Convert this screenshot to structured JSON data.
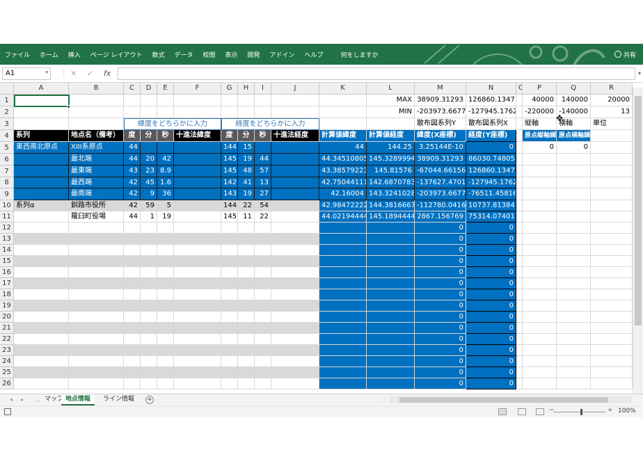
{
  "ribbon": {
    "tabs": [
      "ファイル",
      "ホーム",
      "挿入",
      "ページ レイアウト",
      "数式",
      "データ",
      "校閲",
      "表示",
      "開発",
      "アドイン",
      "ヘルプ",
      "何をしますか"
    ],
    "share": "共有",
    "color": "#217346"
  },
  "formula_bar": {
    "name_box": "A1",
    "cancel": "✕",
    "confirm": "✓",
    "fx": "fx",
    "formula": ""
  },
  "columns": [
    "A",
    "B",
    "C",
    "D",
    "E",
    "F",
    "G",
    "H",
    "I",
    "J",
    "K",
    "L",
    "M",
    "N",
    "O",
    "P",
    "Q",
    "R"
  ],
  "rows": [
    "1",
    "2",
    "3",
    "4",
    "5",
    "6",
    "7",
    "8",
    "9",
    "10",
    "11",
    "12",
    "13",
    "14",
    "15",
    "16",
    "17",
    "18",
    "19",
    "20",
    "21",
    "22",
    "23",
    "24",
    "25",
    "26"
  ],
  "cells": {
    "L1": "MAX",
    "M1": "38909.31293",
    "N1": "126860.1347",
    "P1": "40000",
    "Q1": "140000",
    "R1": "20000",
    "L2": "MIN",
    "M2": "-203973.6677",
    "N2": "-127945.1762",
    "P2": "-220000",
    "Q2": "-140000",
    "R2": "13",
    "C3": "緯度をどちらかに入力",
    "G3": "経度をどちらかに入力",
    "M3": "散布図系列Y",
    "N3": "散布図系列X",
    "P3": "縦軸",
    "Q3": "横軸",
    "R3": "単位",
    "A4": "系列",
    "B4": "地点名（備考）",
    "C4": "度",
    "D4": "分",
    "E4": "秒",
    "F4": "十進法緯度",
    "G4": "度",
    "H4": "分",
    "I4": "秒",
    "J4": "十進法経度",
    "K4": "計算値緯度",
    "L4": "計算値経度",
    "M4": "緯度(X座標)",
    "N4": "経度(Y座標)",
    "P4": "原点縦軸調",
    "Q4": "原点横軸調",
    "A5": "東西南北原点",
    "B5": "XIII系原点",
    "C5": "44",
    "G5": "144",
    "H5": "15",
    "K5": "44",
    "L5": "144.25",
    "M5": "3.25144E-10",
    "N5": "0",
    "P5": "0",
    "Q5": "0",
    "B6": "最北端",
    "C6": "44",
    "D6": "20",
    "E6": "42",
    "G6": "145",
    "H6": "19",
    "I6": "44",
    "K6": "44.34510805",
    "L6": "145.3289994",
    "M6": "38909.31293",
    "N6": "86030.74805",
    "B7": "最東端",
    "C7": "43",
    "D7": "23",
    "E7": "8.9",
    "G7": "145",
    "H7": "48",
    "I7": "57",
    "K7": "43.38579223",
    "L7": "145.81576",
    "M7": "-67044.66156",
    "N7": "126860.1347",
    "B8": "最西端",
    "C8": "42",
    "D8": "45",
    "E8": "1.6",
    "G8": "142",
    "H8": "41",
    "I8": "13",
    "K8": "42.75044111",
    "L8": "142.6870783",
    "M8": "-137627.4701",
    "N8": "-127945.1762",
    "B9": "最南端",
    "C9": "42",
    "D9": "9",
    "E9": "36",
    "G9": "143",
    "H9": "19",
    "I9": "27",
    "K9": "42.16004",
    "L9": "143.3241028",
    "M9": "-203973.6677",
    "N9": "-76511.45816",
    "A10": "系列α",
    "B10": "釧路市役所",
    "C10": "42",
    "D10": "59",
    "E10": "5",
    "G10": "144",
    "H10": "22",
    "I10": "54",
    "K10": "42.98472222",
    "L10": "144.3816667",
    "M10": "-112780.0416",
    "N10": "10737.81384",
    "B11": "羅臼町役場",
    "C11": "44",
    "D11": "1",
    "E11": "19",
    "G11": "145",
    "H11": "11",
    "I11": "22",
    "K11": "44.02194444",
    "L11": "145.1894444",
    "M11": "2867.156769",
    "N11": "75314.07401",
    "M12": "0",
    "N12": "0",
    "M13": "0",
    "N13": "0",
    "M14": "0",
    "N14": "0",
    "M15": "0",
    "N15": "0",
    "M16": "0",
    "N16": "0",
    "M17": "0",
    "N17": "0",
    "M18": "0",
    "N18": "0",
    "M19": "0",
    "N19": "0",
    "M20": "0",
    "N20": "0",
    "M21": "0",
    "N21": "0",
    "M22": "0",
    "N22": "0",
    "M23": "0",
    "N23": "0",
    "M24": "0",
    "N24": "0",
    "M25": "0",
    "N25": "0",
    "M26": "0",
    "N26": "0"
  },
  "sheet_tabs": [
    "マップ",
    "地点情報",
    "ライン情報"
  ],
  "active_tab": "地点情報",
  "status": {
    "zoom": "100%",
    "minus": "−",
    "plus": "+"
  },
  "colors": {
    "header_black": "#000000",
    "blue": "#0070c0",
    "light_blue_border": "#2e75b6",
    "gray_fill": "#d9d9d9",
    "zero_gray": "#f2f2f2",
    "select": "#217346"
  }
}
